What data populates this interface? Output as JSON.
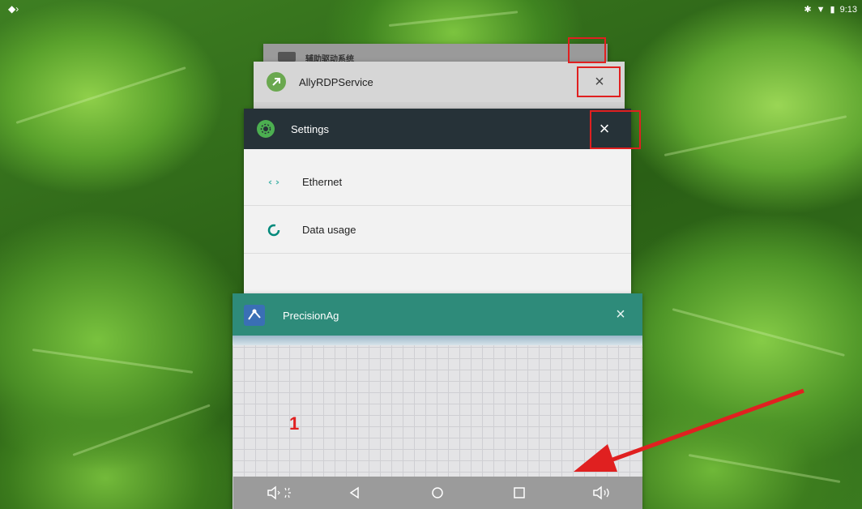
{
  "status_bar": {
    "left_icon": "settings-diamond-icon",
    "right_icons": [
      "bluetooth-icon",
      "wifi-icon",
      "battery-icon"
    ],
    "time": "9:13"
  },
  "recents": {
    "cards": [
      {
        "id": "system",
        "title": "辅助驱动系统",
        "icon": "app-icon"
      },
      {
        "id": "ally",
        "title": "AllyRDPService",
        "icon": "ally-app-icon"
      },
      {
        "id": "settings",
        "title": "Settings",
        "icon": "settings-gear-icon",
        "items": [
          {
            "label": "Ethernet",
            "icon": "ethernet-icon"
          },
          {
            "label": "Data usage",
            "icon": "data-usage-icon"
          }
        ]
      },
      {
        "id": "precision",
        "title": "PrecisionAg",
        "icon": "precisionag-app-icon"
      }
    ],
    "close_glyph": "×"
  },
  "annotation": {
    "step_number": "1",
    "highlight_color": "#e02020"
  },
  "nav_bar": {
    "buttons": [
      {
        "name": "volume-down-button",
        "icon": "volume-down-icon"
      },
      {
        "name": "back-button",
        "icon": "back-triangle-icon"
      },
      {
        "name": "home-button",
        "icon": "home-circle-icon"
      },
      {
        "name": "recents-button",
        "icon": "recents-square-icon"
      },
      {
        "name": "volume-up-button",
        "icon": "volume-up-icon"
      }
    ]
  },
  "colors": {
    "settings_header": "#263238",
    "precision_header": "#2e8b7a",
    "highlight": "#e02020"
  }
}
